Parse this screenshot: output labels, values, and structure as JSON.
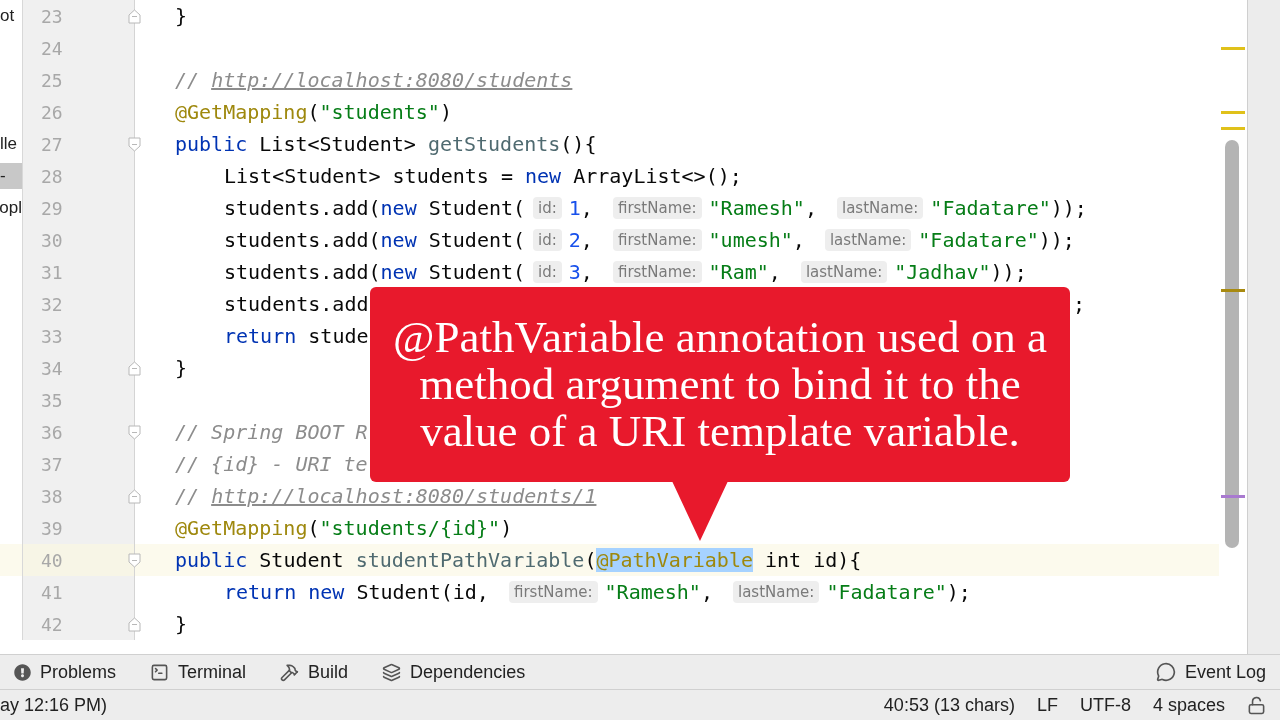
{
  "editor": {
    "lines": [
      {
        "number": "23",
        "fold": {
          "kind": "end"
        },
        "tree": {
          "text": "ot",
          "selected": false
        },
        "tokens": [
          {
            "kind": "plain",
            "text": "}"
          }
        ]
      },
      {
        "number": "24"
      },
      {
        "number": "25",
        "tokens": [
          {
            "kind": "comment",
            "text": "// "
          },
          {
            "kind": "link",
            "text": "http://localhost:8080/students"
          }
        ]
      },
      {
        "number": "26",
        "tokens": [
          {
            "kind": "annotation",
            "text": "@GetMapping"
          },
          {
            "kind": "plain",
            "text": "("
          },
          {
            "kind": "string",
            "text": "\"students\""
          },
          {
            "kind": "plain",
            "text": ")"
          }
        ]
      },
      {
        "number": "27",
        "fold": {
          "kind": "start"
        },
        "tree": {
          "text": "lle",
          "selected": false
        },
        "tokens": [
          {
            "kind": "keyword",
            "text": "public "
          },
          {
            "kind": "plain",
            "text": "List<Student> "
          },
          {
            "kind": "method",
            "text": "getStudents"
          },
          {
            "kind": "plain",
            "text": "(){"
          }
        ]
      },
      {
        "number": "28",
        "indented": true,
        "tree": {
          "text": "-",
          "selected": true
        },
        "tokens": [
          {
            "kind": "plain",
            "text": "List<Student> students = "
          },
          {
            "kind": "keyword",
            "text": "new "
          },
          {
            "kind": "plain",
            "text": "ArrayList<>();"
          }
        ]
      },
      {
        "number": "29",
        "indented": true,
        "tree": {
          "text": "opl",
          "selected": false
        },
        "tokens": [
          {
            "kind": "plain",
            "text": "students.add("
          },
          {
            "kind": "keyword",
            "text": "new "
          },
          {
            "kind": "plain",
            "text": "Student("
          },
          {
            "kind": "hint",
            "text": "id:"
          },
          {
            "kind": "number",
            "text": "1"
          },
          {
            "kind": "plain",
            "text": ", "
          },
          {
            "kind": "hint",
            "text": "firstName:"
          },
          {
            "kind": "string",
            "text": "\"Ramesh\""
          },
          {
            "kind": "plain",
            "text": ", "
          },
          {
            "kind": "hint",
            "text": "lastName:"
          },
          {
            "kind": "string",
            "text": "\"Fadatare\""
          },
          {
            "kind": "plain",
            "text": "));"
          }
        ]
      },
      {
        "number": "30",
        "indented": true,
        "tokens": [
          {
            "kind": "plain",
            "text": "students.add("
          },
          {
            "kind": "keyword",
            "text": "new "
          },
          {
            "kind": "plain",
            "text": "Student("
          },
          {
            "kind": "hint",
            "text": "id:"
          },
          {
            "kind": "number",
            "text": "2"
          },
          {
            "kind": "plain",
            "text": ", "
          },
          {
            "kind": "hint",
            "text": "firstName:"
          },
          {
            "kind": "string",
            "text": "\"umesh\""
          },
          {
            "kind": "plain",
            "text": ", "
          },
          {
            "kind": "hint",
            "text": "lastName:"
          },
          {
            "kind": "string",
            "text": "\"Fadatare\""
          },
          {
            "kind": "plain",
            "text": "));"
          }
        ]
      },
      {
        "number": "31",
        "indented": true,
        "tokens": [
          {
            "kind": "plain",
            "text": "students.add("
          },
          {
            "kind": "keyword",
            "text": "new "
          },
          {
            "kind": "plain",
            "text": "Student("
          },
          {
            "kind": "hint",
            "text": "id:"
          },
          {
            "kind": "number",
            "text": "3"
          },
          {
            "kind": "plain",
            "text": ", "
          },
          {
            "kind": "hint",
            "text": "firstName:"
          },
          {
            "kind": "string",
            "text": "\"Ram\""
          },
          {
            "kind": "plain",
            "text": ", "
          },
          {
            "kind": "hint",
            "text": "lastName:"
          },
          {
            "kind": "string",
            "text": "\"Jadhav\""
          },
          {
            "kind": "plain",
            "text": "));"
          }
        ]
      },
      {
        "number": "32",
        "indented": true,
        "tokens": [
          {
            "kind": "plain",
            "text": "students.add"
          },
          {
            "kind": "tail",
            "text": ";"
          }
        ]
      },
      {
        "number": "33",
        "indented": true,
        "tokens": [
          {
            "kind": "keyword",
            "text": "return "
          },
          {
            "kind": "plain",
            "text": "stude"
          }
        ]
      },
      {
        "number": "34",
        "fold": {
          "kind": "end"
        },
        "tokens": [
          {
            "kind": "plain",
            "text": "}"
          }
        ]
      },
      {
        "number": "35"
      },
      {
        "number": "36",
        "fold": {
          "kind": "start"
        },
        "tokens": [
          {
            "kind": "comment",
            "text": "// Spring BOOT R"
          }
        ]
      },
      {
        "number": "37",
        "tokens": [
          {
            "kind": "comment",
            "text": "// {id} - URI te"
          }
        ]
      },
      {
        "number": "38",
        "fold": {
          "kind": "end"
        },
        "tokens": [
          {
            "kind": "comment",
            "text": "// "
          },
          {
            "kind": "link",
            "text": "http://localhost:8080/students/1"
          }
        ]
      },
      {
        "number": "39",
        "tokens": [
          {
            "kind": "annotation",
            "text": "@GetMapping"
          },
          {
            "kind": "plain",
            "text": "("
          },
          {
            "kind": "string",
            "text": "\"students/{id}\""
          },
          {
            "kind": "plain",
            "text": ")"
          }
        ]
      },
      {
        "number": "40",
        "fold": {
          "kind": "start"
        },
        "current": true,
        "tokens": [
          {
            "kind": "keyword",
            "text": "public "
          },
          {
            "kind": "plain",
            "text": "Student "
          },
          {
            "kind": "method",
            "text": "studentPathVariable"
          },
          {
            "kind": "plain",
            "text": "("
          },
          {
            "kind": "annotation",
            "text": "@PathVariable",
            "selected": true
          },
          {
            "kind": "plain",
            "text": " int id){"
          }
        ]
      },
      {
        "number": "41",
        "indented": true,
        "tokens": [
          {
            "kind": "keyword",
            "text": "return new "
          },
          {
            "kind": "plain",
            "text": "Student(id, "
          },
          {
            "kind": "hint",
            "text": "firstName:"
          },
          {
            "kind": "string",
            "text": "\"Ramesh\""
          },
          {
            "kind": "plain",
            "text": ", "
          },
          {
            "kind": "hint",
            "text": "lastName:"
          },
          {
            "kind": "string",
            "text": "\"Fadatare\""
          },
          {
            "kind": "plain",
            "text": ");"
          }
        ]
      },
      {
        "number": "42",
        "fold": {
          "kind": "end"
        },
        "tokens": [
          {
            "kind": "plain",
            "text": "}"
          }
        ]
      }
    ]
  },
  "callout": {
    "text": "@PathVariable annotation used on a method argument to bind it to the value of a URI template variable."
  },
  "tool_windows": {
    "left": [
      {
        "kind": "problems",
        "label": "Problems"
      },
      {
        "kind": "terminal",
        "label": "Terminal"
      },
      {
        "kind": "build",
        "label": "Build"
      },
      {
        "kind": "dependencies",
        "label": "Dependencies"
      }
    ],
    "right": [
      {
        "kind": "eventlog",
        "label": "Event Log"
      }
    ]
  },
  "status_bar": {
    "message": "ay 12:16 PM)",
    "items": [
      "40:53 (13 chars)",
      "LF",
      "UTF-8",
      "4 spaces"
    ]
  }
}
